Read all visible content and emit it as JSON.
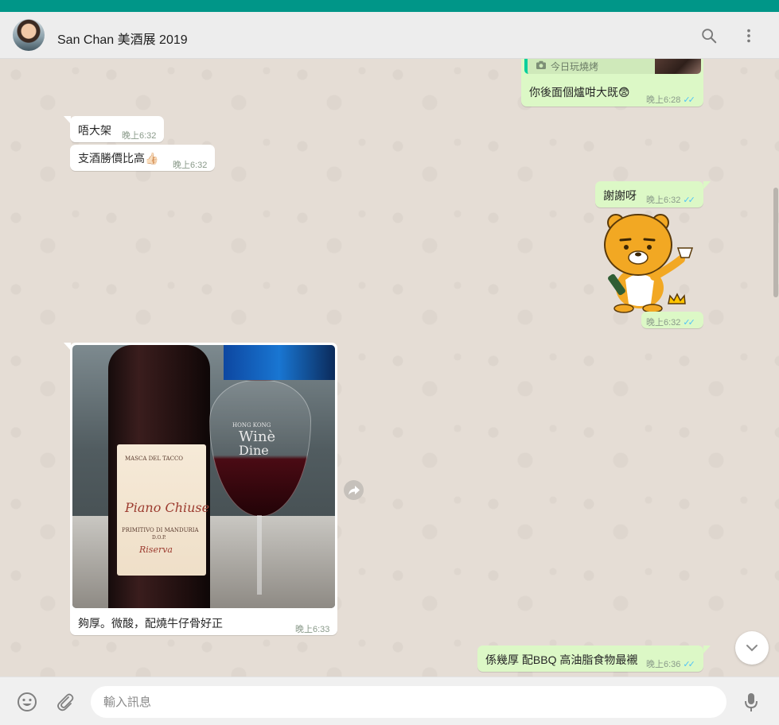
{
  "colors": {
    "accent": "#009688",
    "incoming_bubble": "#ffffff",
    "outgoing_bubble": "#dcf8c6",
    "read_ticks": "#4fc3f7",
    "chat_background": "#e5ddd5"
  },
  "header": {
    "contact_name": "San Chan 美酒展 2019",
    "icons": [
      "search-icon",
      "menu-icon"
    ]
  },
  "messages": {
    "quoted_reply": {
      "label": "今日玩燒烤",
      "icon": "camera-icon"
    },
    "m1": {
      "text": "你後面個爐咁大既😨",
      "time": "晚上6:28",
      "ticks": "✓✓"
    },
    "m2": {
      "text": "唔大架",
      "time": "晚上6:32"
    },
    "m3": {
      "text": "支酒勝價比高👍🏻",
      "time": "晚上6:32"
    },
    "m4": {
      "text": "謝謝呀",
      "time": "晚上6:32",
      "ticks": "✓✓"
    },
    "m5": {
      "sticker": "bear-sticker",
      "time": "晚上6:32",
      "ticks": "✓✓"
    },
    "m6": {
      "caption": "夠厚。微酸，配燒牛仔骨好正",
      "time": "晚上6:33",
      "photo_text": {
        "label_top": "MASCA DEL TACCO",
        "label_name": "Piano Chiuse",
        "label_sub": "PRIMITIVO DI MANDURIA",
        "label_dop": "D.O.P.",
        "label_reserve": "Riserva",
        "glass_small": "HONG KONG",
        "glass_big_1": "Winè",
        "glass_big_2": "Dine"
      }
    },
    "m7": {
      "text": "係幾厚 配BBQ 高油脂食物最襯",
      "time": "晚上6:36",
      "ticks": "✓✓"
    }
  },
  "composer": {
    "placeholder": "輸入訊息",
    "icons": [
      "emoji-icon",
      "attach-icon",
      "microphone-icon"
    ]
  }
}
